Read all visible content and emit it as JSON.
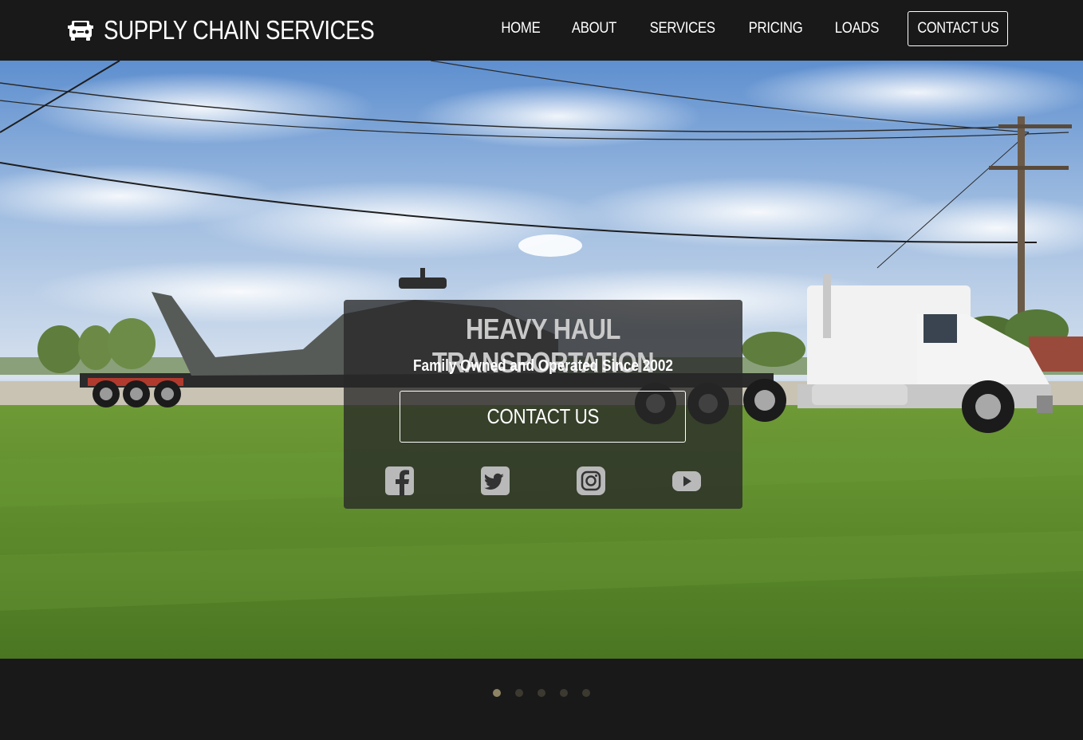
{
  "navbar": {
    "brand": {
      "icon": "truck-icon",
      "title": "SUPPLY CHAIN SERVICES"
    },
    "links": [
      "HOME",
      "ABOUT",
      "SERVICES",
      "PRICING",
      "LOADS"
    ],
    "contact_label": "CONTACT US"
  },
  "hero": {
    "background": "photo-helicopter-on-flatbed-truck",
    "title": "HEAVY HAUL TRANSPORTATION",
    "subtitle": "Family Owned and Operated Since 2002",
    "button_label": "CONTACT US",
    "socials": [
      "facebook-icon",
      "twitter-icon",
      "instagram-icon",
      "youtube-icon"
    ]
  },
  "slider": {
    "count": 5,
    "active_index": 0
  },
  "colors": {
    "nav_bg": "#191919",
    "card_bg": "rgba(40,40,40,0.78)",
    "dot_active": "#8e8463",
    "dot_inactive": "#3c3a30"
  }
}
